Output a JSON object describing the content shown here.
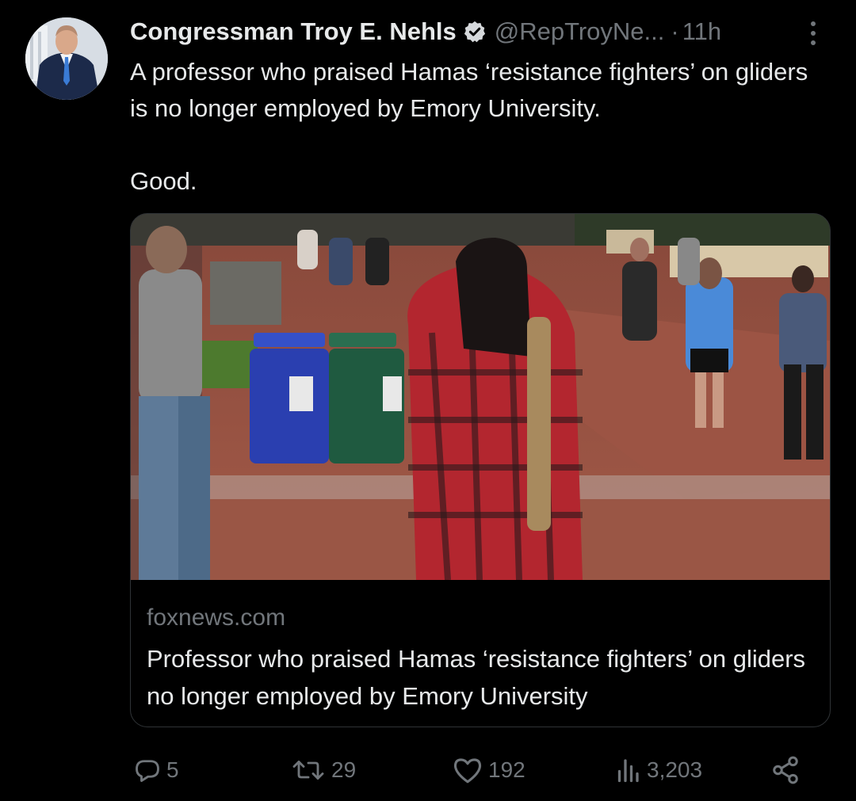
{
  "tweet": {
    "display_name": "Congressman Troy E. Nehls",
    "verified_icon": "verified-badge-icon",
    "handle": "@RepTroyNe...",
    "separator": "·",
    "time": "11h",
    "text": "A professor who praised Hamas ‘resistance fighters’ on gliders is no longer employed by Emory University.\n\nGood.",
    "more_icon": "more-vertical-icon"
  },
  "card": {
    "domain": "foxnews.com",
    "title": "Professor who praised Hamas ‘resistance fighters’ on gliders no longer employed by Emory University"
  },
  "actions": {
    "reply_count": "5",
    "retweet_count": "29",
    "like_count": "192",
    "views_count": "3,203"
  },
  "colors": {
    "background": "#000000",
    "text_primary": "#e7e9ea",
    "text_secondary": "#71767b",
    "border": "#2f3336"
  }
}
